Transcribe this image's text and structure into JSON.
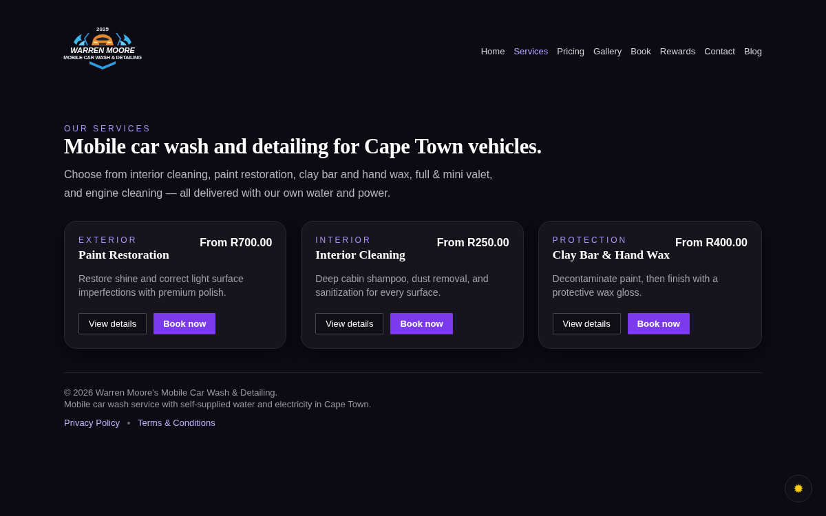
{
  "header": {
    "logo": {
      "badge": "2025",
      "name": "WARREN MOORE",
      "tagline": "MOBILE CAR WASH & DETAILING"
    },
    "nav": [
      {
        "label": "Home",
        "selected": false
      },
      {
        "label": "Services",
        "selected": true
      },
      {
        "label": "Pricing",
        "selected": false
      },
      {
        "label": "Gallery",
        "selected": false
      },
      {
        "label": "Book",
        "selected": false
      },
      {
        "label": "Rewards",
        "selected": false
      },
      {
        "label": "Contact",
        "selected": false
      },
      {
        "label": "Blog",
        "selected": false
      }
    ]
  },
  "hero": {
    "eyebrow": "OUR SERVICES",
    "title": "Mobile car wash and detailing for Cape Town vehicles.",
    "description": "Choose from interior cleaning, paint restoration, clay bar and hand wax, full & mini valet, and engine cleaning — all delivered with our own water and power."
  },
  "services": [
    {
      "category": "EXTERIOR",
      "title": "Paint Restoration",
      "price": "From R700.00",
      "description": "Restore shine and correct light surface imperfections with premium polish.",
      "buttons": [
        {
          "label": "View details",
          "kind": "secondary"
        },
        {
          "label": "Book now",
          "kind": "primary"
        }
      ]
    },
    {
      "category": "INTERIOR",
      "title": "Interior Cleaning",
      "price": "From R250.00",
      "description": "Deep cabin shampoo, dust removal, and sanitization for every surface.",
      "buttons": [
        {
          "label": "View details",
          "kind": "secondary"
        },
        {
          "label": "Book now",
          "kind": "primary"
        }
      ]
    },
    {
      "category": "PROTECTION",
      "title": "Clay Bar & Hand Wax",
      "price": "From R400.00",
      "description": "Decontaminate paint, then finish with a protective wax gloss.",
      "buttons": [
        {
          "label": "View details",
          "kind": "secondary"
        },
        {
          "label": "Book now",
          "kind": "primary"
        }
      ]
    }
  ],
  "footer": {
    "copyright": "© 2026 Warren Moore's Mobile Car Wash & Detailing.",
    "tagline": "Mobile car wash service with self-supplied water and electricity in Cape Town.",
    "links": [
      "Privacy Policy",
      "Terms & Conditions"
    ]
  }
}
